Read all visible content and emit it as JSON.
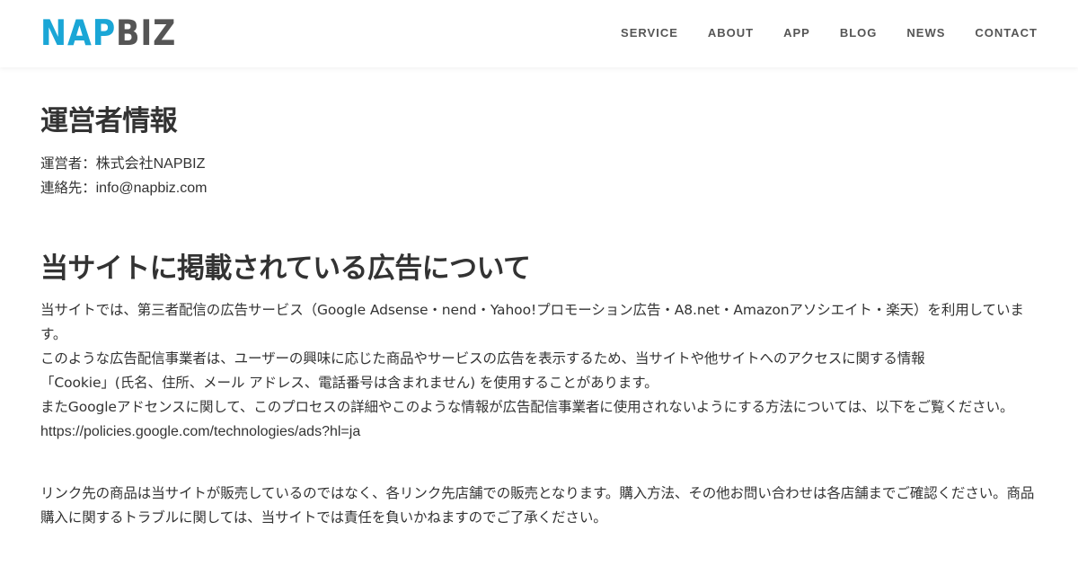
{
  "header": {
    "logo": {
      "part1": "NAP",
      "part2": "BIZ"
    },
    "nav": [
      "SERVICE",
      "ABOUT",
      "APP",
      "BLOG",
      "NEWS",
      "CONTACT"
    ]
  },
  "operator": {
    "title": "運営者情報",
    "operator_label": "運営者：",
    "operator_value": "株式会社NAPBIZ",
    "contact_label": "連絡先：",
    "contact_value": "info@napbiz.com"
  },
  "ads": {
    "title": "当サイトに掲載されている広告について",
    "line1": "当サイトでは、第三者配信の広告サービス（Google Adsense・nend・Yahoo!プロモーション広告・A8.net・Amazonアソシエイト・楽天）を利用しています。",
    "line2": "このような広告配信事業者は、ユーザーの興味に応じた商品やサービスの広告を表示するため、当サイトや他サイトへのアクセスに関する情報",
    "line3": "「Cookie」(氏名、住所、メール アドレス、電話番号は含まれません) を使用することがあります。",
    "line4": "またGoogleアドセンスに関して、このプロセスの詳細やこのような情報が広告配信事業者に使用されないようにする方法については、以下をご覧ください。",
    "link": "https://policies.google.com/technologies/ads?hl=ja",
    "note": "リンク先の商品は当サイトが販売しているのではなく、各リンク先店舗での販売となります。購入方法、その他お問い合わせは各店舗までご確認ください。商品購入に関するトラブルに関しては、当サイトでは責任を負いかねますのでご了承ください。"
  }
}
